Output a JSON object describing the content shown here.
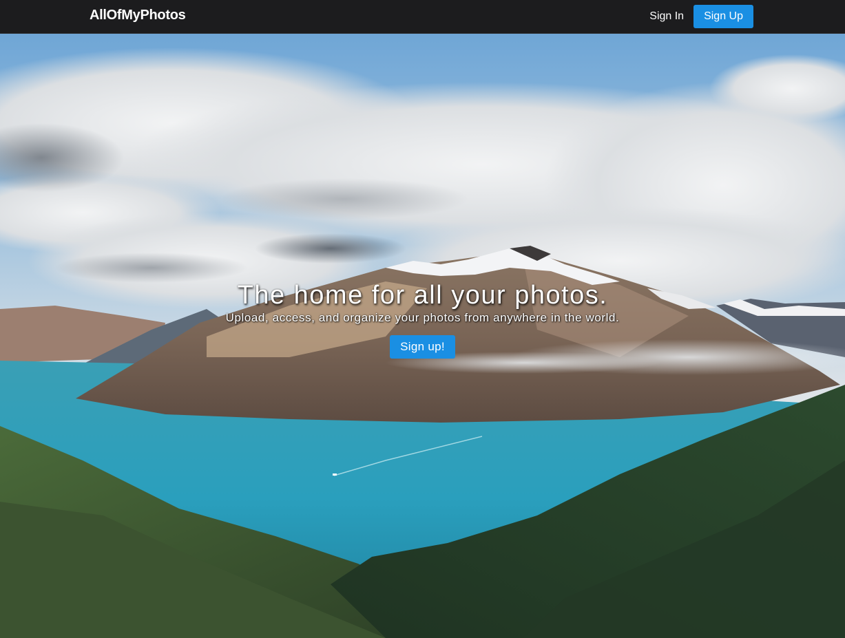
{
  "navbar": {
    "brand": "AllOfMyPhotos",
    "signin_label": "Sign In",
    "signup_label": "Sign Up"
  },
  "hero": {
    "title": "The home for all your photos.",
    "subtitle": "Upload, access, and organize your photos from anywhere in the world.",
    "cta_label": "Sign up!",
    "background": "mountain-lake-landscape"
  },
  "colors": {
    "navbar_bg": "#1c1c1e",
    "accent": "#1a8fe3",
    "text": "#ffffff"
  }
}
